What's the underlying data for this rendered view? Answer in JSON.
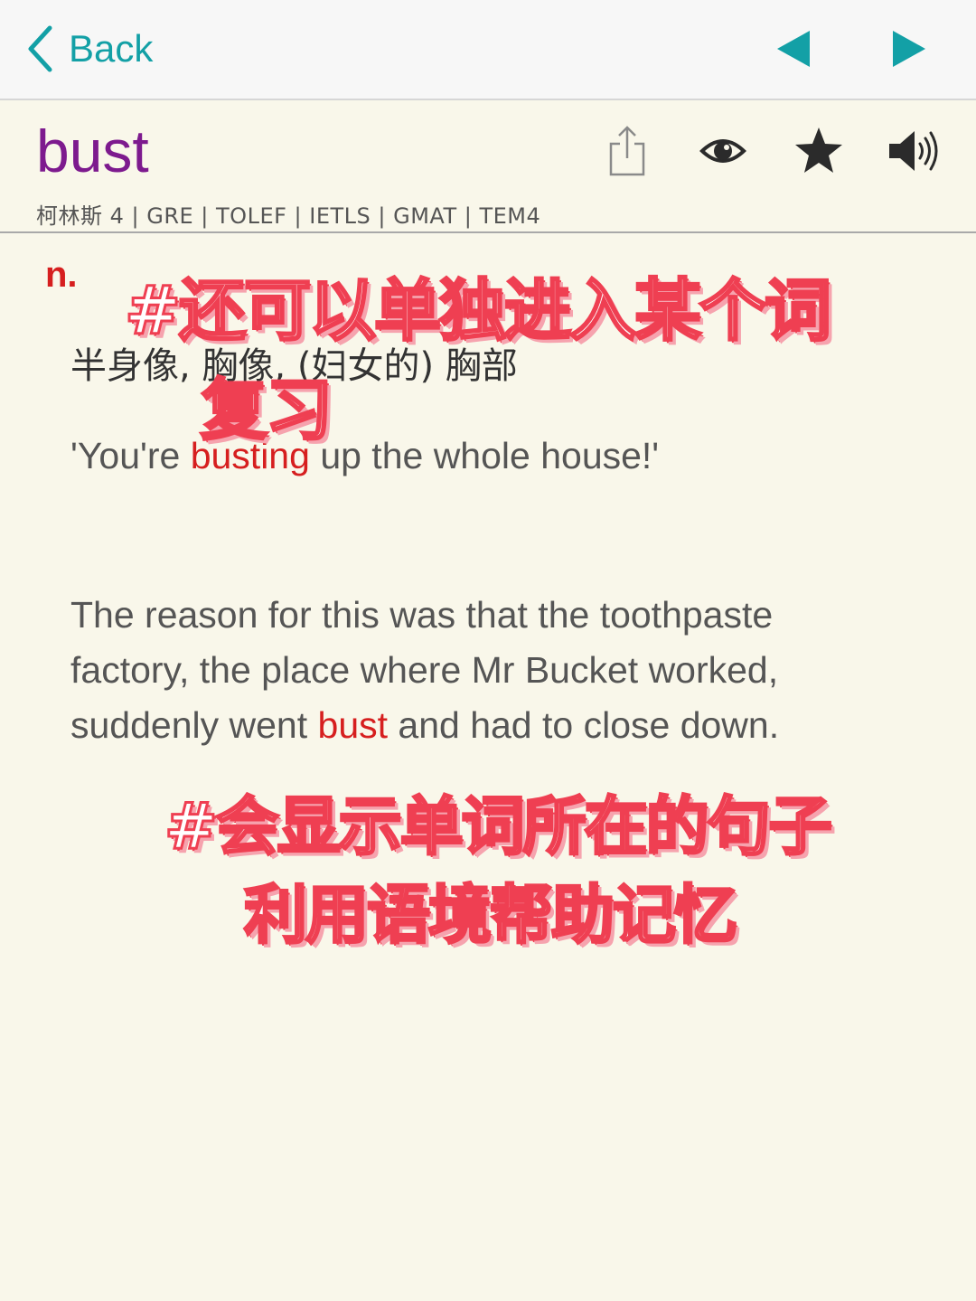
{
  "nav": {
    "back_label": "Back",
    "prev_icon": "triangle-left-icon",
    "next_icon": "triangle-right-icon",
    "accent_color": "#13a0a6"
  },
  "entry": {
    "word": "bust",
    "tags": "柯林斯 4 | GRE | TOLEF | IETLS | GMAT | TEM4",
    "word_color": "#7d1a8e",
    "tools": [
      "share-icon",
      "eye-icon",
      "star-icon",
      "speaker-icon"
    ]
  },
  "definition": {
    "part_of_speech": "n.",
    "meaning": "半身像, 胸像, (妇女的) 胸部"
  },
  "examples": [
    {
      "before": "'You're ",
      "highlight": "busting",
      "after": " up the whole house!'"
    },
    {
      "before": "The reason for this was that the toothpaste factory, the place where Mr Bucket worked, suddenly went ",
      "highlight": "bust",
      "after": " and had to close down."
    }
  ],
  "highlight_color": "#d61f1f",
  "annotations": {
    "line1a": "#还可以单独进入某个词",
    "line1b": "复习",
    "line2a": "#会显示单词所在的句子",
    "line2b": "利用语境帮助记忆"
  }
}
